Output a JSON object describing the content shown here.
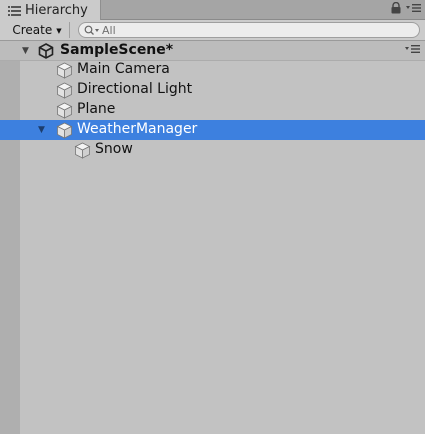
{
  "panel": {
    "tab_title": "Hierarchy",
    "tab_icon": "list-icon",
    "controls": [
      "lock-icon",
      "menu-icon"
    ]
  },
  "toolbar": {
    "create_label": "Create",
    "search": {
      "placeholder": "All",
      "icon": "search-icon"
    }
  },
  "scene": {
    "name": "SampleScene*",
    "icon": "unity-logo-icon",
    "menu_icon": "menu-icon"
  },
  "objects": [
    {
      "label": "Main Camera",
      "icon": "cube-icon",
      "depth": 1,
      "selected": false
    },
    {
      "label": "Directional Light",
      "icon": "cube-icon",
      "depth": 1,
      "selected": false
    },
    {
      "label": "Plane",
      "icon": "cube-icon",
      "depth": 1,
      "selected": false
    },
    {
      "label": "WeatherManager",
      "icon": "cube-icon",
      "depth": 1,
      "selected": true,
      "expanded": true
    },
    {
      "label": "Snow",
      "icon": "cube-icon",
      "depth": 2,
      "selected": false
    }
  ],
  "colors": {
    "selection": "#3d80df",
    "panel_bg": "#c2c2c2",
    "gutter": "#afafaf"
  }
}
